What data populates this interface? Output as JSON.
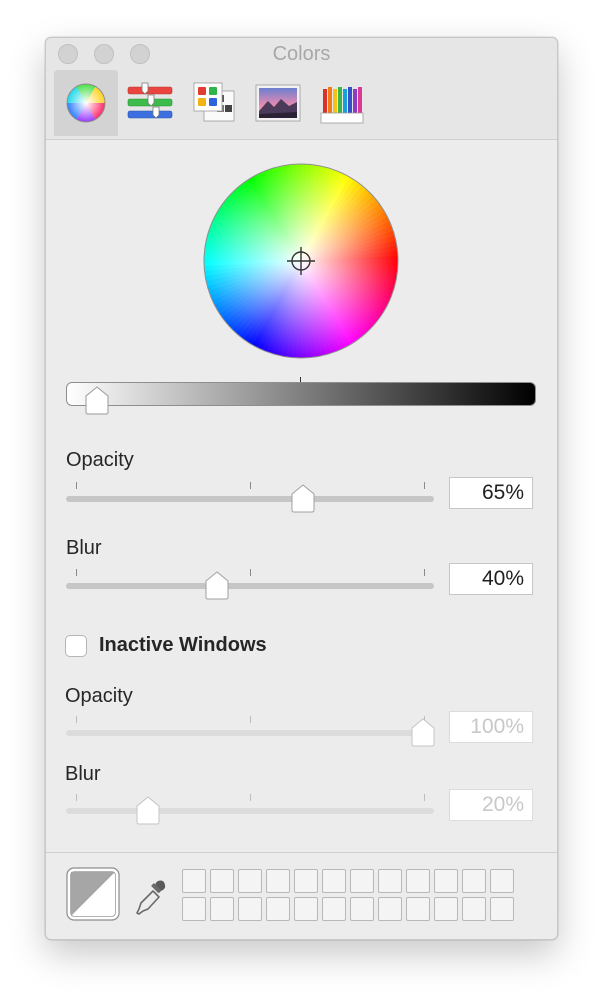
{
  "window": {
    "title": "Colors"
  },
  "toolbar": {
    "tabs": [
      {
        "id": "color-wheel",
        "icon": "color-wheel-icon",
        "selected": true
      },
      {
        "id": "color-sliders",
        "icon": "color-sliders-icon",
        "selected": false
      },
      {
        "id": "color-palettes",
        "icon": "color-palettes-icon",
        "selected": false
      },
      {
        "id": "image-palettes",
        "icon": "image-palettes-icon",
        "selected": false
      },
      {
        "id": "pencils",
        "icon": "pencils-icon",
        "selected": false
      }
    ]
  },
  "brightness": {
    "level": 0.04
  },
  "opacity": {
    "label": "Opacity",
    "value": "65%",
    "level": 0.65
  },
  "blur": {
    "label": "Blur",
    "value": "40%",
    "level": 0.4
  },
  "inactive": {
    "label": "Inactive Windows",
    "checked": false,
    "opacity": {
      "label": "Opacity",
      "value": "100%",
      "level": 1.0
    },
    "blur": {
      "label": "Blur",
      "value": "20%",
      "level": 0.2
    }
  },
  "colors": {
    "accent_dim": "#c8c8c8",
    "window_bg": "#ececec"
  }
}
